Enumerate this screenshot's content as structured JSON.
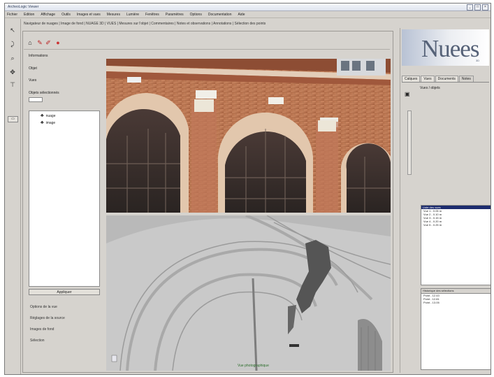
{
  "window": {
    "title": "ArcheoLogic Viewer"
  },
  "menu": [
    "Fichier",
    "Edition",
    "Affichage",
    "Outils",
    "Images et vues",
    "Mesures",
    "Lumière",
    "Fenêtres",
    "Paramètres",
    "Options",
    "Documentation",
    "Aide"
  ],
  "infobar": "Navigateur de nuages | Image de fond | NUAGE 3D | VUES | Mesures sur l'objet | Commentaires | Notes et observations | Annotations | Sélection des points",
  "left_panel": {
    "labels": [
      "Informations",
      "Objet",
      "Vues",
      "Objets sélectionnés"
    ],
    "combo_value": "",
    "tree_items": [
      "nuage",
      "image"
    ],
    "apply_label": "Appliquer",
    "options": [
      "Options de la vue",
      "Réglages de la source",
      "Images de fond",
      "Sélection"
    ]
  },
  "right_panel": {
    "logo_text": "Nuees",
    "logo_sub": "3D",
    "tabs": [
      "Calques",
      "Vues",
      "Documents",
      "Notes"
    ],
    "info_label": "Vues / objets",
    "list1_header": "Liste des vues",
    "list1_rows": [
      "Vue 1 - 0.05 m",
      "Vue 2 - 0.10 m",
      "Vue 3 - 0.15 m",
      "Vue 4 - 0.20 m",
      "Vue 5 - 0.25 m"
    ],
    "list2_header": "Historique des sélections",
    "list2_rows": [
      "Point - 12.43",
      "Point - 12.81",
      "Point - 13.05"
    ]
  },
  "views": {
    "status_label": "Vue photographique"
  },
  "icons": {
    "tool1": "pointer-icon",
    "tool2": "rotate-icon",
    "tool3": "zoom-icon",
    "tool4": "pan-icon",
    "tool5": "measure-icon"
  }
}
